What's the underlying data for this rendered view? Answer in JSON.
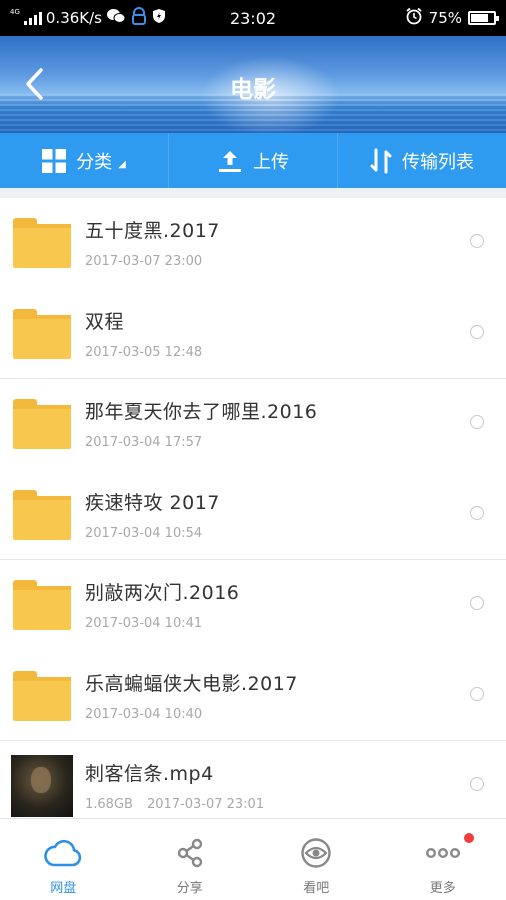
{
  "status_bar": {
    "network": "4G",
    "speed": "0.36K/s",
    "time": "23:02",
    "battery": "75%",
    "battery_level": 0.75
  },
  "header": {
    "title": "电影"
  },
  "toolbar": {
    "category_label": "分类",
    "upload_label": "上传",
    "transfer_label": "传输列表"
  },
  "files": [
    {
      "name": "五十度黑.2017",
      "size": "",
      "date": "2017-03-07 23:00",
      "type": "folder"
    },
    {
      "name": "双程",
      "size": "",
      "date": "2017-03-05 12:48",
      "type": "folder"
    },
    {
      "name": "那年夏天你去了哪里.2016",
      "size": "",
      "date": "2017-03-04 17:57",
      "type": "folder"
    },
    {
      "name": "疾速特攻 2017",
      "size": "",
      "date": "2017-03-04 10:54",
      "type": "folder"
    },
    {
      "name": "别敲两次门.2016",
      "size": "",
      "date": "2017-03-04 10:41",
      "type": "folder"
    },
    {
      "name": "乐高蝙蝠侠大电影.2017",
      "size": "",
      "date": "2017-03-04 10:40",
      "type": "folder"
    },
    {
      "name": "刺客信条.mp4",
      "size": "1.68GB",
      "date": "2017-03-07 23:01",
      "type": "video"
    }
  ],
  "bottom_nav": [
    {
      "label": "网盘",
      "icon": "cloud-icon",
      "active": true
    },
    {
      "label": "分享",
      "icon": "share-icon",
      "active": false
    },
    {
      "label": "看吧",
      "icon": "eye-icon",
      "active": false
    },
    {
      "label": "更多",
      "icon": "more-icon",
      "active": false
    }
  ],
  "colors": {
    "accent": "#2e9bf0",
    "folder": "#f8c74e",
    "active_tab": "#2e8fe6",
    "badge": "#f23c3c"
  }
}
